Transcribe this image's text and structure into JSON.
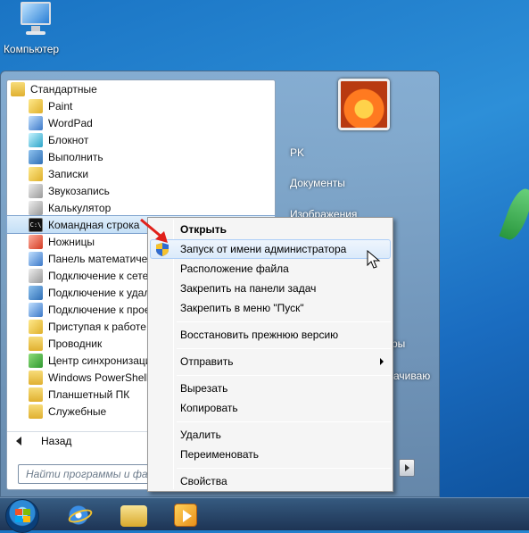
{
  "desktop": {
    "computer_label": "Компьютер"
  },
  "start_menu": {
    "programs": [
      {
        "label": "Стандартные",
        "icon": "folder-icon",
        "level": 0
      },
      {
        "label": "Paint",
        "icon": "paint-icon",
        "level": 1
      },
      {
        "label": "WordPad",
        "icon": "wordpad-icon",
        "level": 1
      },
      {
        "label": "Блокнот",
        "icon": "notepad-icon",
        "level": 1
      },
      {
        "label": "Выполнить",
        "icon": "run-icon",
        "level": 1
      },
      {
        "label": "Записки",
        "icon": "sticky-notes-icon",
        "level": 1
      },
      {
        "label": "Звукозапись",
        "icon": "sound-recorder-icon",
        "level": 1
      },
      {
        "label": "Калькулятор",
        "icon": "calculator-icon",
        "level": 1
      },
      {
        "label": "Командная строка",
        "icon": "cmd-icon",
        "level": 1,
        "selected": true
      },
      {
        "label": "Ножницы",
        "icon": "scissors-icon",
        "level": 1
      },
      {
        "label": "Панель математического ввода",
        "icon": "math-input-icon",
        "level": 1
      },
      {
        "label": "Подключение к сетевому проектору",
        "icon": "network-projector-icon",
        "level": 1
      },
      {
        "label": "Подключение к удаленному рабочему столу",
        "icon": "remote-desktop-icon",
        "level": 1
      },
      {
        "label": "Подключение к проектору",
        "icon": "projector-icon",
        "level": 1
      },
      {
        "label": "Приступая к работе",
        "icon": "getting-started-icon",
        "level": 1
      },
      {
        "label": "Проводник",
        "icon": "explorer-icon",
        "level": 1
      },
      {
        "label": "Центр синхронизации",
        "icon": "sync-center-icon",
        "level": 1
      },
      {
        "label": "Windows PowerShell",
        "icon": "folder-icon",
        "level": 1
      },
      {
        "label": "Планшетный ПК",
        "icon": "folder-icon",
        "level": 1
      },
      {
        "label": "Служебные",
        "icon": "folder-icon",
        "level": 1
      }
    ],
    "back_label": "Назад",
    "search_placeholder": "Найти программы и файлы",
    "right_items": {
      "user": "PK",
      "documents": "Документы",
      "images": "Изображения",
      "frag1": "ры",
      "frag2": "ачиваю"
    }
  },
  "context_menu": {
    "open": "Открыть",
    "run_as_admin": "Запуск от имени администратора",
    "file_location": "Расположение файла",
    "pin_taskbar": "Закрепить на панели задач",
    "pin_start": "Закрепить в меню \"Пуск\"",
    "restore_previous": "Восстановить прежнюю версию",
    "send_to": "Отправить",
    "cut": "Вырезать",
    "copy": "Копировать",
    "delete": "Удалить",
    "rename": "Переименовать",
    "properties": "Свойства"
  }
}
